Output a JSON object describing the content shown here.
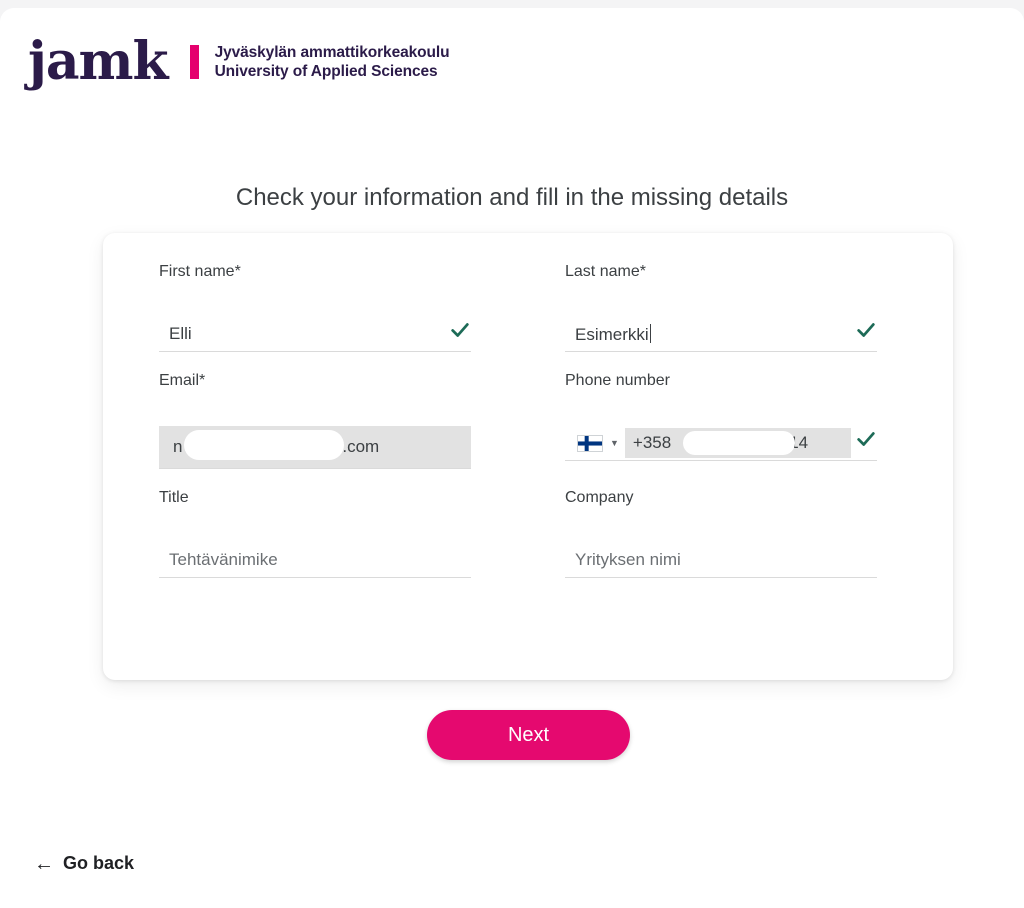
{
  "brand": {
    "wordmark": "jamk",
    "line1": "Jyväskylän ammattikorkeakoulu",
    "line2": "University of Applied Sciences",
    "wordmark_color": "#2b1b49",
    "rule_color": "#e5006d"
  },
  "heading": "Check your information and fill in the missing details",
  "form": {
    "fields": {
      "first_name": {
        "label": "First name*",
        "value": "Elli",
        "valid": true
      },
      "last_name": {
        "label": "Last name*",
        "value": "Esimerkki",
        "valid": true
      },
      "email": {
        "label": "Email*",
        "value_prefix": "n",
        "value_suffix": "@gmail.com",
        "readonly": true
      },
      "phone": {
        "label": "Phone number",
        "country_flag": "finland-flag",
        "country_code": "+358",
        "value_suffix": "14",
        "valid": true
      },
      "title": {
        "label": "Title",
        "placeholder": "Tehtävänimike",
        "value": ""
      },
      "company": {
        "label": "Company",
        "placeholder": "Yrityksen nimi",
        "value": ""
      }
    }
  },
  "actions": {
    "next_label": "Next",
    "next_color": "#e5096f",
    "go_back_label": "Go back",
    "go_back_arrow": "←"
  },
  "colors": {
    "check": "#1d6b57",
    "text": "#3c4043",
    "readonly_bg": "#e2e2e2",
    "underline": "#dadada"
  }
}
